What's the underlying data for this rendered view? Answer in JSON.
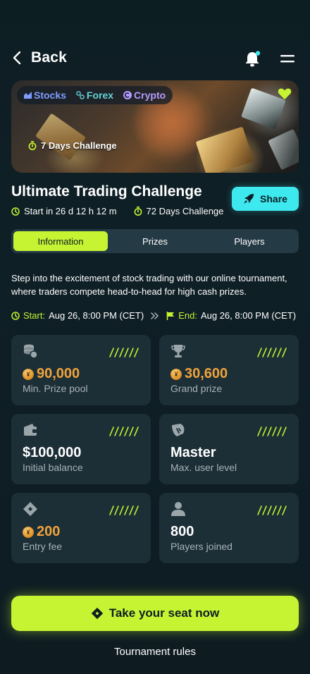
{
  "header": {
    "back_label": "Back"
  },
  "hero": {
    "chips": [
      "Stocks",
      "Forex",
      "Crypto"
    ],
    "days_label": "7 Days Challenge"
  },
  "challenge": {
    "title": "Ultimate Trading Challenge",
    "start_countdown": "Start in 26 d 12 h 12 m",
    "duration": "72 Days Challenge",
    "share_label": "Share"
  },
  "tabs": [
    "Information",
    "Prizes",
    "Players"
  ],
  "description": "Step into the excitement of stock trading with our online tournament, where traders compete head-to-head for high cash prizes.",
  "dates": {
    "start_label": "Start:",
    "start_value": "Aug 26, 8:00 PM (CET)",
    "end_label": "End:",
    "end_value": "Aug 26, 8:00 PM (CET)"
  },
  "stats": [
    {
      "value": "90,000",
      "label": "Min. Prize pool",
      "icon": "coins-icon"
    },
    {
      "value": "30,600",
      "label": "Grand prize",
      "icon": "trophy-icon"
    },
    {
      "value": "$100,000",
      "label": "Initial balance",
      "icon": "wallet-icon"
    },
    {
      "value": "Master",
      "label": "Max. user level",
      "icon": "level-icon"
    },
    {
      "value": "200",
      "label": "Entry fee",
      "icon": "ticket-icon"
    },
    {
      "value": "800",
      "label": "Players joined",
      "icon": "user-icon"
    }
  ],
  "cta_label": "Take your seat now",
  "rules_label": "Tournament rules",
  "colors": {
    "accent": "#c6f432",
    "share": "#3ee8ef",
    "gold": "#f0a33b",
    "card": "#1c2e36",
    "background": "#0d1e23"
  }
}
